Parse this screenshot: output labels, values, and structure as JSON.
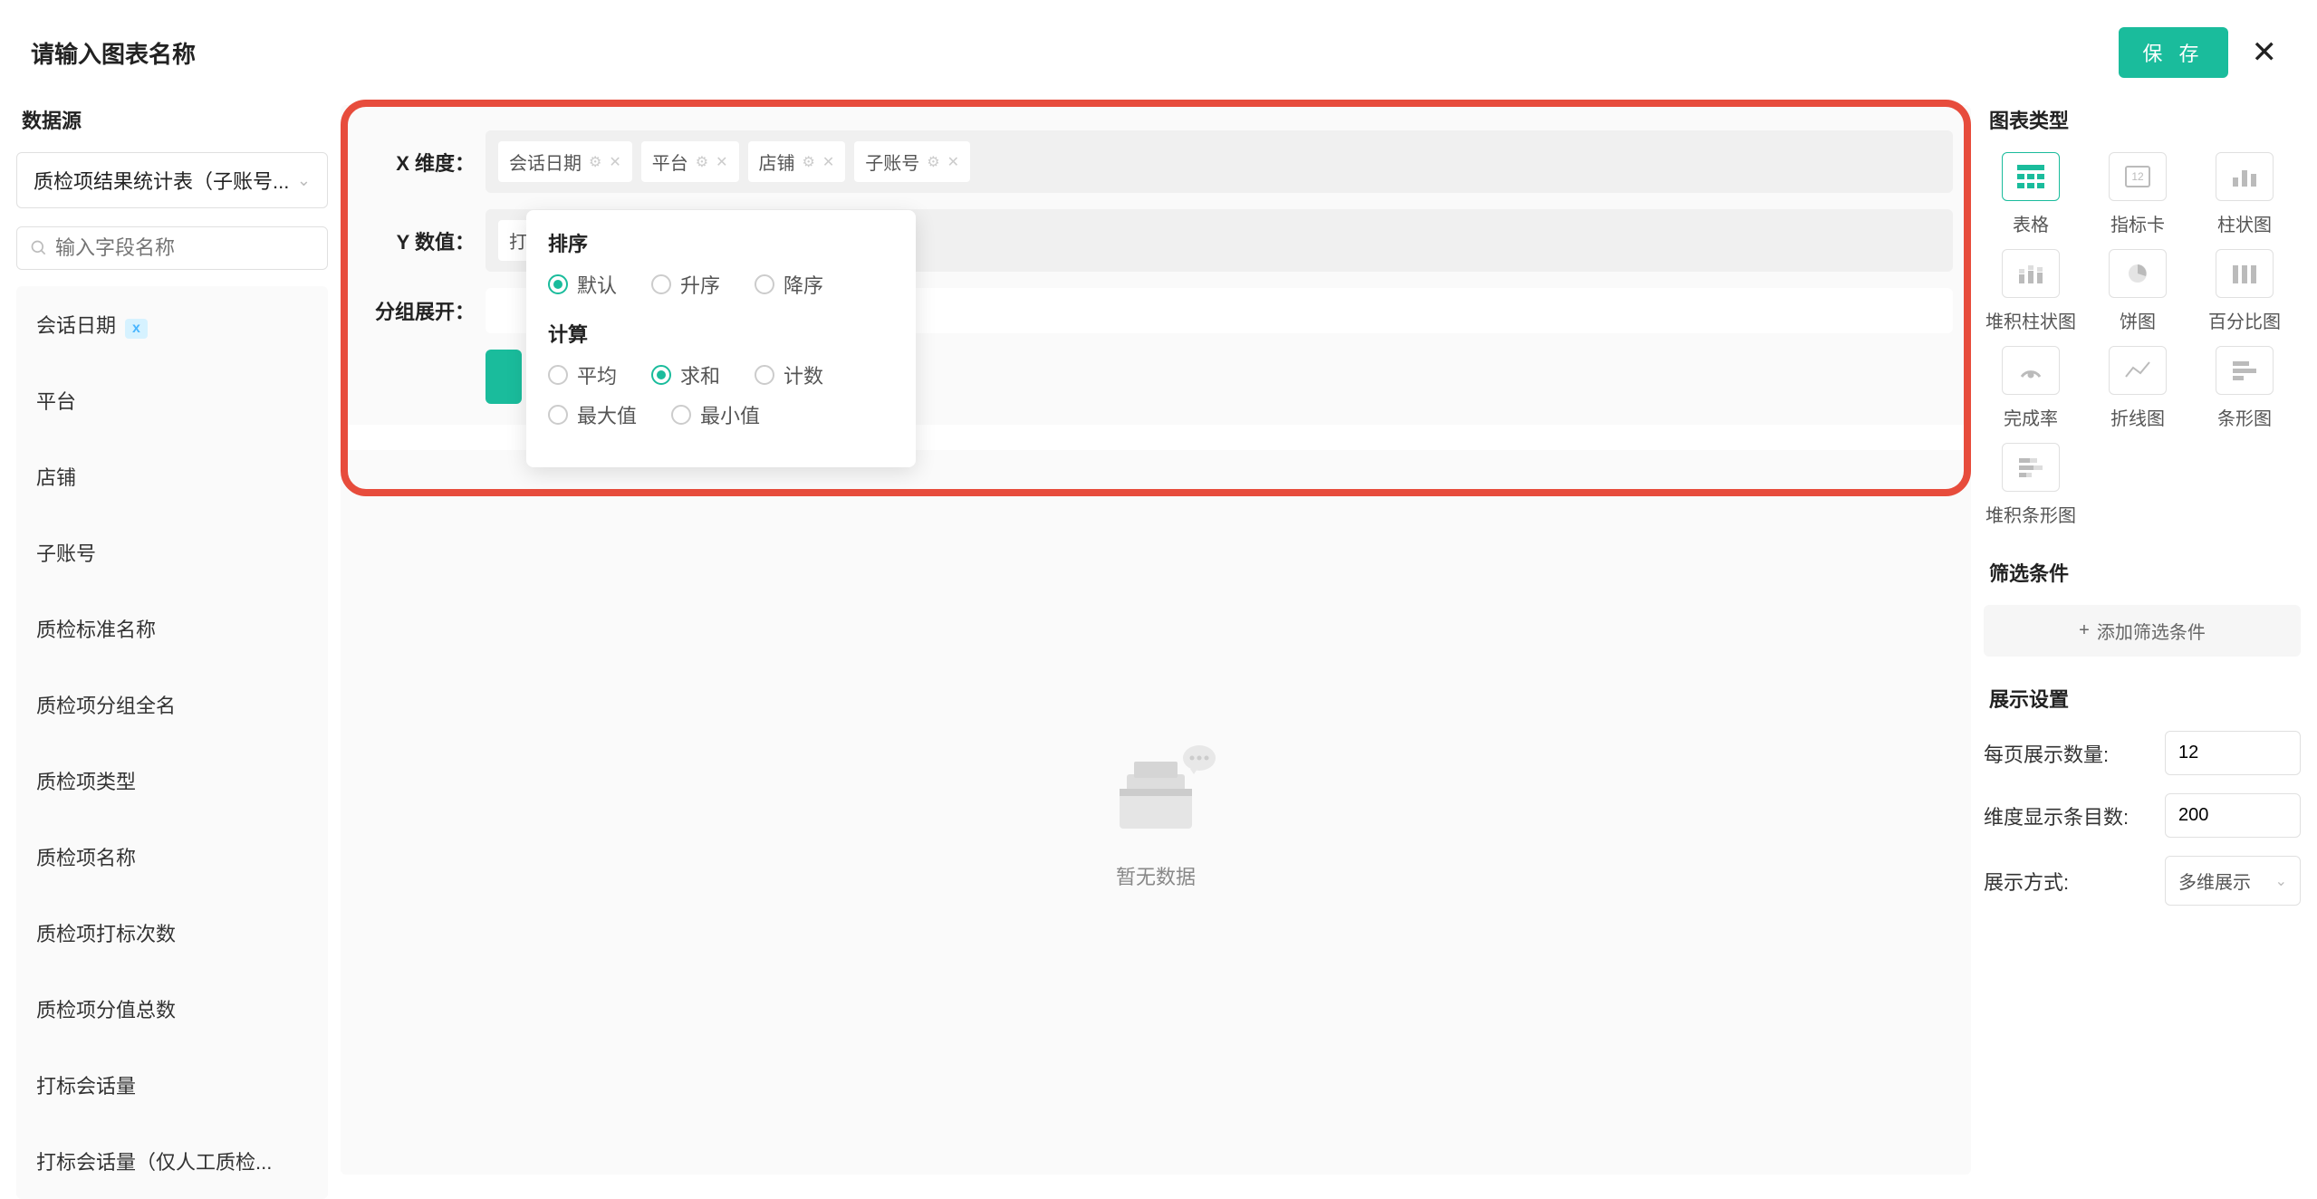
{
  "header": {
    "title": "请输入图表名称",
    "save_label": "保 存"
  },
  "sidebar": {
    "title": "数据源",
    "datasource_selected": "质检项结果统计表（子账号...",
    "search_placeholder": "输入字段名称",
    "fields": [
      {
        "label": "会话日期",
        "tag": "x"
      },
      {
        "label": "平台"
      },
      {
        "label": "店铺"
      },
      {
        "label": "子账号"
      },
      {
        "label": "质检标准名称"
      },
      {
        "label": "质检项分组全名"
      },
      {
        "label": "质检项类型"
      },
      {
        "label": "质检项名称"
      },
      {
        "label": "质检项打标次数"
      },
      {
        "label": "质检项分值总数"
      },
      {
        "label": "打标会话量"
      },
      {
        "label": "打标会话量（仅人工质检..."
      }
    ]
  },
  "config": {
    "x_label": "X 维度：",
    "y_label": "Y 数值：",
    "group_label": "分组展开：",
    "x_dims": [
      "会话日期",
      "平台",
      "店铺",
      "子账号"
    ],
    "y_values": [
      "打标会话量"
    ]
  },
  "popover": {
    "sort_title": "排序",
    "sort_options": [
      "默认",
      "升序",
      "降序"
    ],
    "sort_selected": "默认",
    "calc_title": "计算",
    "calc_options": [
      "平均",
      "求和",
      "计数",
      "最大值",
      "最小值"
    ],
    "calc_selected": "求和"
  },
  "empty": {
    "text": "暂无数据"
  },
  "right": {
    "chart_type_title": "图表类型",
    "chart_types": [
      {
        "key": "table",
        "label": "表格",
        "active": true
      },
      {
        "key": "indicator",
        "label": "指标卡"
      },
      {
        "key": "bar",
        "label": "柱状图"
      },
      {
        "key": "stacked_bar",
        "label": "堆积柱状图"
      },
      {
        "key": "pie",
        "label": "饼图"
      },
      {
        "key": "percent",
        "label": "百分比图"
      },
      {
        "key": "completion",
        "label": "完成率"
      },
      {
        "key": "line",
        "label": "折线图"
      },
      {
        "key": "hbar",
        "label": "条形图"
      },
      {
        "key": "stacked_hbar",
        "label": "堆积条形图"
      }
    ],
    "filter_title": "筛选条件",
    "add_filter_label": "添加筛选条件",
    "display_title": "展示设置",
    "per_page_label": "每页展示数量:",
    "per_page_value": "12",
    "dim_count_label": "维度显示条目数:",
    "dim_count_value": "200",
    "display_mode_label": "展示方式:",
    "display_mode_value": "多维展示"
  }
}
